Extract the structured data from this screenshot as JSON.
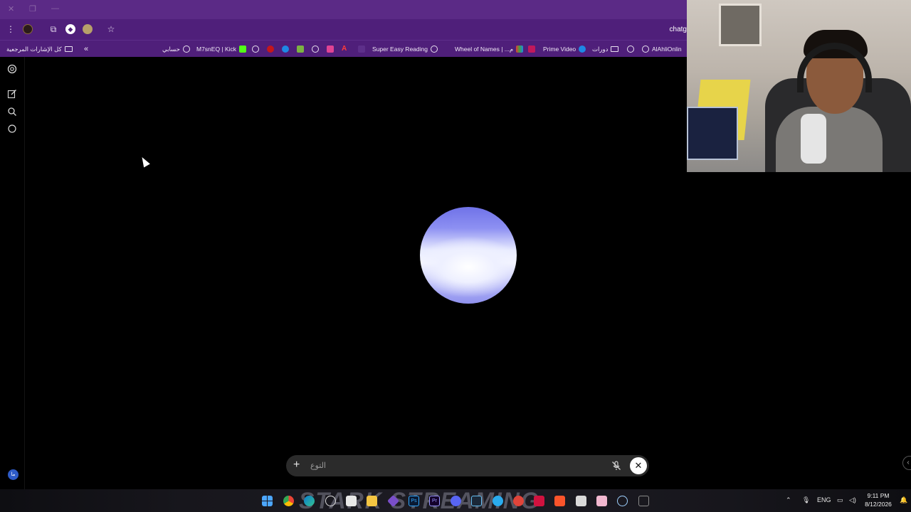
{
  "browser": {
    "url_partial": "chatg",
    "bookmarks": [
      {
        "label": "AlAhliOnlin",
        "icon": "globe-icon"
      },
      {
        "label": "",
        "icon": "globe-icon"
      },
      {
        "label": "دورات",
        "icon": "folder-icon"
      },
      {
        "label": "Prime Video",
        "icon": "prime-video-icon"
      },
      {
        "label": "",
        "icon": "app-icon"
      },
      {
        "label": "Wheel of Names | ...م",
        "icon": "globe-icon"
      },
      {
        "label": "Super Easy Reading",
        "icon": "globe-icon"
      },
      {
        "label": "M7snEQ | Kick",
        "icon": "kick-icon"
      },
      {
        "label": "حسابي",
        "icon": "globe-icon"
      }
    ],
    "all_bookmarks_label": "كل الإشارات المرجعية",
    "overflow_chevron": "«"
  },
  "chatgpt": {
    "composer_placeholder": "التوع",
    "plus_label": "+",
    "close_label": "✕",
    "avatar_initials": "ما"
  },
  "taskbar": {
    "language": "ENG",
    "time": "9:11 PM",
    "date": "8/12/2026",
    "background_text": "STARK STREAMING"
  },
  "colors": {
    "title_bar": "#5b2a86",
    "toolbar": "#4f1f7a",
    "orb_top": "#6f72e8",
    "orb_center": "#f5f6ff"
  }
}
